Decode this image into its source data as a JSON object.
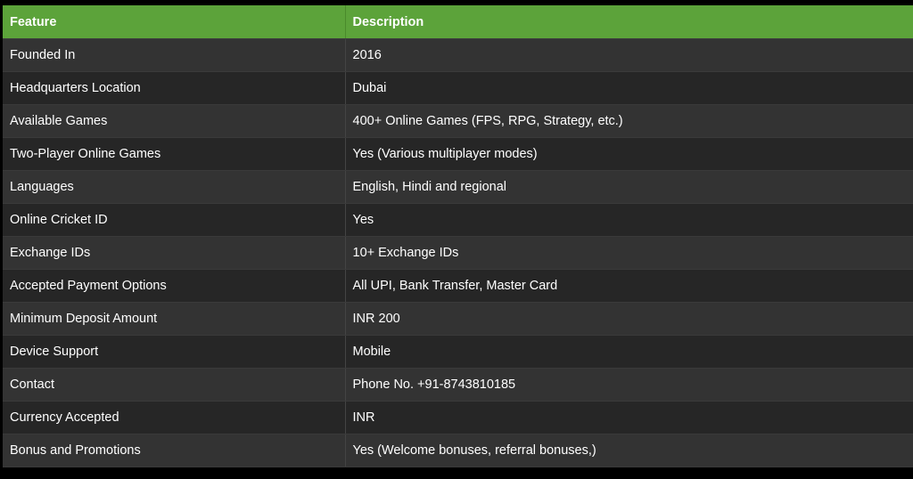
{
  "table": {
    "headers": [
      "Feature",
      "Description"
    ],
    "rows": [
      [
        "Founded In",
        "2016"
      ],
      [
        "Headquarters Location",
        "Dubai"
      ],
      [
        "Available Games",
        "400+ Online Games (FPS, RPG, Strategy, etc.)"
      ],
      [
        "Two-Player Online Games",
        "Yes (Various multiplayer modes)"
      ],
      [
        "Languages",
        "English, Hindi and regional"
      ],
      [
        "Online Cricket ID",
        "Yes"
      ],
      [
        "Exchange IDs",
        "10+ Exchange IDs"
      ],
      [
        "Accepted Payment Options",
        "All UPI, Bank Transfer, Master Card"
      ],
      [
        "Minimum Deposit Amount",
        "INR 200"
      ],
      [
        "Device Support",
        "Mobile"
      ],
      [
        "Contact",
        "Phone No. +91-8743810185"
      ],
      [
        "Currency Accepted",
        "INR"
      ],
      [
        "Bonus and Promotions",
        "Yes (Welcome bonuses, referral bonuses,)"
      ]
    ]
  },
  "colors": {
    "header_bg": "#5ca33a",
    "row_odd_bg": "#333333",
    "row_even_bg": "#262626",
    "text": "#ffffff",
    "page_bg": "#000000"
  }
}
